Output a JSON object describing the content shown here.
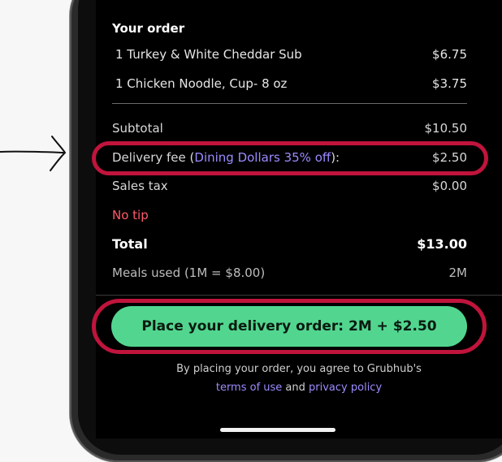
{
  "order": {
    "title": "Your order",
    "items": [
      {
        "label": "1 Turkey & White Cheddar Sub",
        "price": "$6.75"
      },
      {
        "label": "1 Chicken Noodle, Cup- 8 oz",
        "price": "$3.75"
      }
    ]
  },
  "summary": {
    "subtotal_label": "Subtotal",
    "subtotal_value": "$10.50",
    "delivery_label_prefix": "Delivery fee (",
    "delivery_discount": "Dining Dollars 35% off",
    "delivery_label_suffix": "):",
    "delivery_value": "$2.50",
    "tax_label": "Sales tax",
    "tax_value": "$0.00",
    "tip_label": "No tip",
    "total_label": "Total",
    "total_value": "$13.00",
    "meals_label": "Meals used (1M = $8.00)",
    "meals_value": "2M"
  },
  "cta": {
    "label": "Place your delivery order: 2M + $2.50"
  },
  "legal": {
    "line1": "By placing your order, you agree to Grubhub's",
    "terms": "terms of use",
    "and": " and ",
    "privacy": "privacy policy"
  },
  "colors": {
    "accent": "#9b8cff",
    "cta_green": "#52d68f",
    "highlight_ring": "#c0143c",
    "tip_red": "#ff5a6a"
  }
}
